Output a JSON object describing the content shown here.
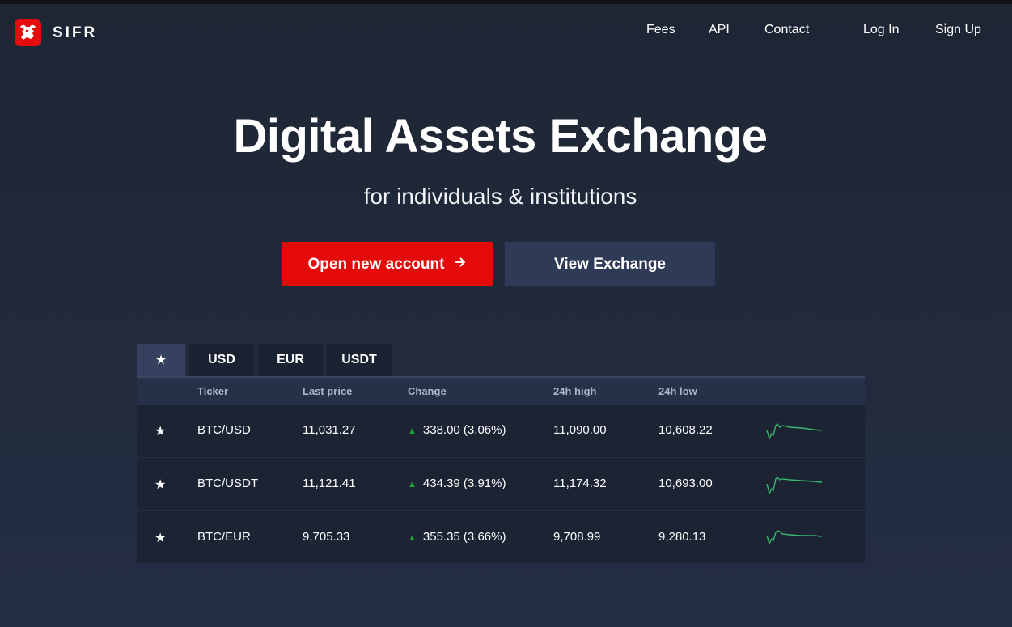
{
  "brand": {
    "name": "SIFR",
    "logo_icon": "bull-logo-icon",
    "color": "#e30d0d"
  },
  "nav": {
    "fees": "Fees",
    "api": "API",
    "contact": "Contact",
    "login": "Log In",
    "signup": "Sign Up"
  },
  "hero": {
    "title": "Digital Assets Exchange",
    "subtitle": "for individuals & institutions",
    "primary_button": "Open new account",
    "primary_icon": "arrow-right-icon",
    "secondary_button": "View Exchange"
  },
  "market": {
    "tabs": [
      "★",
      "USD",
      "EUR",
      "USDT"
    ],
    "active_tab": "★",
    "columns": [
      "Ticker",
      "Last price",
      "Change",
      "24h high",
      "24h low"
    ],
    "rows": [
      {
        "ticker": "BTC/USD",
        "last": "11,031.27",
        "change": "338.00 (3.06%)",
        "high": "11,090.00",
        "low": "10,608.22"
      },
      {
        "ticker": "BTC/USDT",
        "last": "11,121.41",
        "change": "434.39 (3.91%)",
        "high": "11,174.32",
        "low": "10,693.00"
      },
      {
        "ticker": "BTC/EUR",
        "last": "9,705.33",
        "change": "355.35 (3.66%)",
        "high": "9,708.99",
        "low": "9,280.13"
      }
    ],
    "star_glyph": "★",
    "up_glyph": "▲",
    "positive_color": "#1ea43a"
  }
}
